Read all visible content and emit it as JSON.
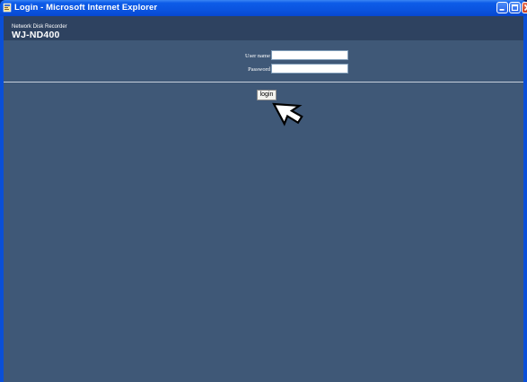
{
  "window": {
    "title": "Login - Microsoft Internet Explorer"
  },
  "header": {
    "subtitle": "Network Disk Recorder",
    "model": "WJ-ND400"
  },
  "form": {
    "username_label": "User name",
    "username_value": "",
    "password_label": "Password",
    "password_value": "",
    "login_label": "login"
  },
  "colors": {
    "titlebar": "#0a54e0",
    "header": "#2e4260",
    "background": "#3f5877",
    "close_button": "#c6401f"
  },
  "icons": [
    "ie-app-icon",
    "minimize-icon",
    "maximize-icon",
    "close-icon",
    "mouse-pointer-icon"
  ]
}
